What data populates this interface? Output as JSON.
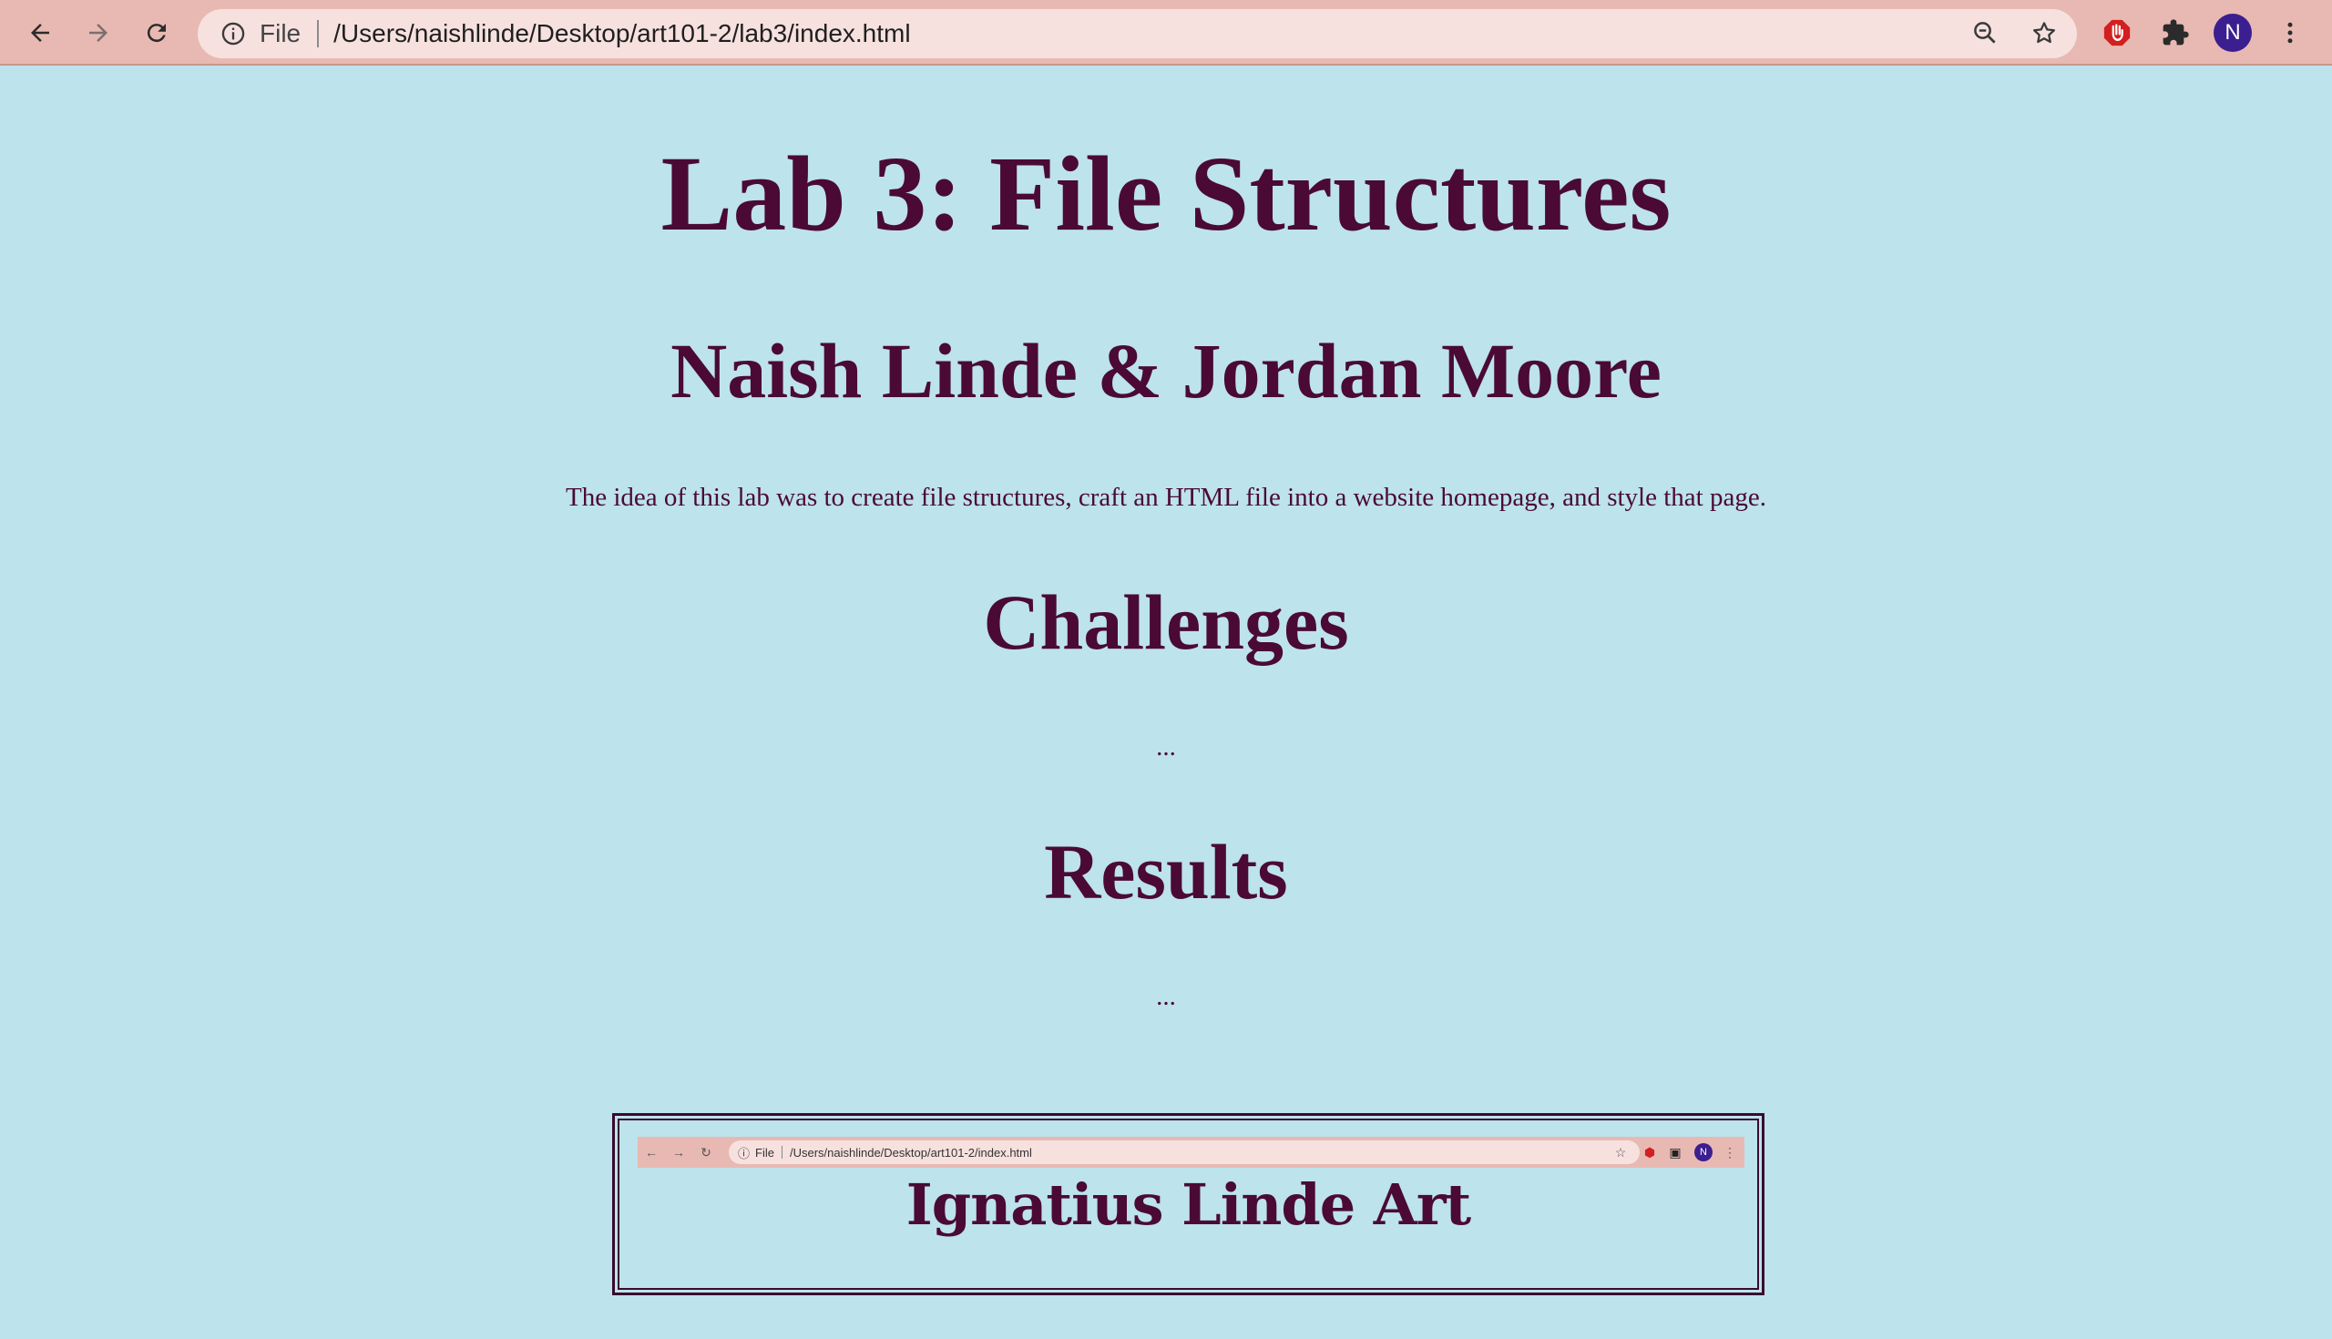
{
  "browser": {
    "scheme_label": "File",
    "url": "/Users/naishlinde/Desktop/art101-2/lab3/index.html",
    "avatar_letter": "N",
    "icons": [
      "back-icon",
      "forward-icon",
      "reload-icon",
      "info-icon",
      "zoom-icon",
      "star-icon",
      "adblock-icon",
      "extensions-icon",
      "menu-icon"
    ],
    "colors": {
      "toolbar": "#e8b9b2",
      "omnibox": "#f6e1de",
      "avatar": "#3b1e8f"
    }
  },
  "page": {
    "title": "Lab 3: File Structures",
    "authors": "Naish Linde & Jordan Moore",
    "intro": "The idea of this lab was to create file structures, craft an HTML file into a website homepage, and style that page.",
    "challenges_heading": "Challenges",
    "challenges_text": "...",
    "results_heading": "Results",
    "results_text": "...",
    "colors": {
      "background": "#bde3ec",
      "text": "#4a0a35"
    }
  },
  "embedded_screenshot": {
    "scheme_label": "File",
    "url": "/Users/naishlinde/Desktop/art101-2/index.html",
    "avatar_letter": "N",
    "title": "Ignatius Linde Art"
  }
}
